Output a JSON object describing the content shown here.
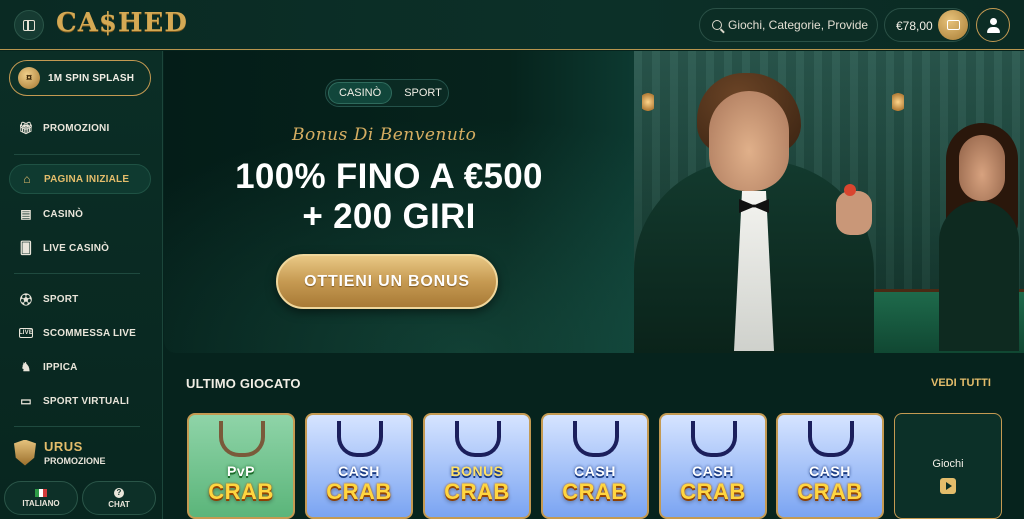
{
  "header": {
    "logo": "CA$HED",
    "search_placeholder": "Giochi, Categorie, Provider",
    "balance": "€78,00"
  },
  "sidebar": {
    "promo_pill": "1M SPIN SPLASH",
    "items": [
      {
        "label": "PROMOZIONI",
        "icon": "gift-icon"
      },
      {
        "label": "PAGINA INIZIALE",
        "icon": "home-icon",
        "active": true
      },
      {
        "label": "CASINÒ",
        "icon": "slot-machine-icon"
      },
      {
        "label": "LIVE CASINÒ",
        "icon": "cards-icon"
      },
      {
        "label": "SPORT",
        "icon": "soccer-ball-icon"
      },
      {
        "label": "SCOMMESSA LIVE",
        "icon": "live-icon"
      },
      {
        "label": "IPPICA",
        "icon": "horse-icon"
      },
      {
        "label": "SPORT VIRTUALI",
        "icon": "monitor-icon"
      }
    ],
    "urus_title": "URUS",
    "urus_subtitle": "PROMOZIONE",
    "language": "ITALIANO",
    "chat": "CHAT"
  },
  "hero": {
    "switch_casino": "CASINÒ",
    "switch_sport": "SPORT",
    "bonus_script": "Bonus Di Benvenuto",
    "headline_line1": "100% FINO A €500",
    "headline_line2": "+ 200 GIRI",
    "cta": "OTTIENI UN BONUS"
  },
  "recent": {
    "title": "ULTIMO GIOCATO",
    "see_all": "VEDI TUTTI",
    "games": [
      {
        "top": "PvP",
        "bottom": "CRAB"
      },
      {
        "top": "CASH",
        "bottom": "CRAB"
      },
      {
        "top": "BONUS",
        "bottom": "CRAB"
      },
      {
        "top": "CASH",
        "bottom": "CRAB"
      },
      {
        "top": "CASH",
        "bottom": "CRAB"
      },
      {
        "top": "CASH",
        "bottom": "CRAB"
      }
    ],
    "more_label": "Giochi"
  },
  "colors": {
    "background": "#06231d",
    "gold": "#c49a52",
    "gold_text": "#e4bd6b",
    "panel": "#0c2d25"
  }
}
